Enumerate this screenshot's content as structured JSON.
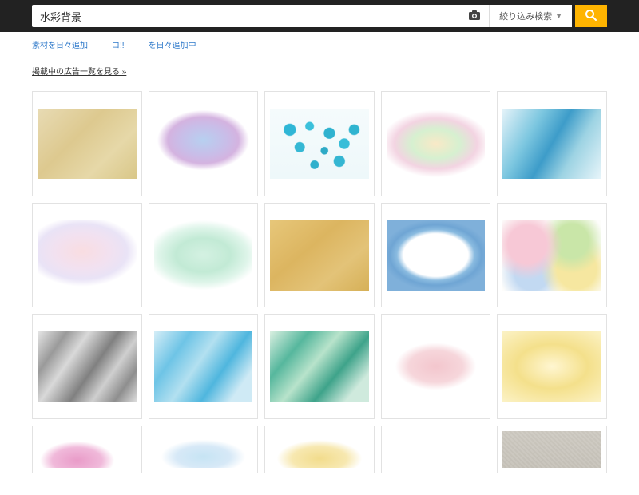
{
  "search": {
    "value": "水彩背景",
    "filter_label": "絞り込み検索"
  },
  "ad_snippets": [
    "素材を日々追加",
    "コ!!",
    "を日々追加中"
  ],
  "ads_list_link": "掲載中の広告一覧を見る »",
  "thumbs": {
    "row1": [
      {
        "name": "beige-paper",
        "bg": "linear-gradient(135deg,#e8dbb4 0%,#ddc98f 40%,#e6d8a8 70%,#d9c788 100%)"
      },
      {
        "name": "pastel-purple-blue",
        "bg": "radial-gradient(ellipse 60% 55% at 50% 45%, #b7d0f0 0%, #c9bde8 40%, #d4b3e0 60%, #fff 78%)"
      },
      {
        "name": "cyan-spots",
        "bg": "radial-gradient(circle at 20% 30%,#2fb6d6 0 6%,transparent 7%),radial-gradient(circle at 40% 25%,#3bc0db 0 5%,transparent 6%),radial-gradient(circle at 60% 35%,#2fb2cf 0 7%,transparent 8%),radial-gradient(circle at 30% 55%,#35b8d4 0 6%,transparent 7%),radial-gradient(circle at 55% 60%,#2daac6 0 5%,transparent 6%),radial-gradient(circle at 75% 50%,#38bdd8 0 6%,transparent 7%),radial-gradient(circle at 45% 80%,#2fb0cc 0 5%,transparent 6%),radial-gradient(circle at 70% 75%,#34b6d2 0 6%,transparent 7%),radial-gradient(circle at 85% 30%,#30b4d0 0 5%,transparent 6%),linear-gradient(#f5fbfc,#eef8fa)"
      },
      {
        "name": "pastel-green-pink",
        "bg": "radial-gradient(ellipse 70% 60% at 50% 50%, #f9e9c7 0%, #d6f0d0 35%, #f3d4e2 60%, #fff 80%)"
      },
      {
        "name": "blue-teal-wash",
        "bg": "linear-gradient(120deg,#e5f3f9 0%,#7dc7e0 30%,#3d9cc9 50%,#9dd3e3 70%,#e8f5fa 100%)"
      }
    ],
    "row2": [
      {
        "name": "pink-lilac-soft",
        "bg": "radial-gradient(ellipse 70% 60% at 45% 45%, #f9dde1 0%, #f2e1f0 40%, #e9e3f6 65%, #fff 82%)"
      },
      {
        "name": "mint-wash",
        "bg": "radial-gradient(ellipse 70% 60% at 50% 50%, #d4f1e2 0%, #c2ead5 40%, #dff5ea 65%, #fff 82%)"
      },
      {
        "name": "ochre-paper",
        "bg": "linear-gradient(140deg,#e7c77a 0%,#dcb560 40%,#e3c378 70%,#d6b057 100%)"
      },
      {
        "name": "blue-frame",
        "bg": "radial-gradient(ellipse 55% 50% at 50% 50%, #fff 0%, #fff 60%, #8abbe0 72%, #6fa5d4 85%, #7fb0da 100%)"
      },
      {
        "name": "rainbow-soft",
        "bg": "radial-gradient(circle at 25% 35%,#f7c8d6 0 22%,transparent 40%),radial-gradient(circle at 70% 30%,#c9e6a8 0 20%,transparent 38%),radial-gradient(circle at 75% 70%,#f6e7a0 0 22%,transparent 40%),radial-gradient(circle at 30% 75%,#c2d9f2 0 20%,transparent 38%),#fdfdfb"
      }
    ],
    "row3": [
      {
        "name": "grey-grunge",
        "bg": "linear-gradient(125deg,#e6e6e6 0%,#9a9a9a 20%,#d9d9d9 35%,#808080 55%,#cfcfcf 70%,#8e8e8e 85%,#dcdcdc 100%)"
      },
      {
        "name": "cyan-ice",
        "bg": "linear-gradient(125deg,#d4edf7 0%,#6ec4e6 25%,#b3e0f0 45%,#4fb6de 65%,#cfeaf5 85%)"
      },
      {
        "name": "teal-green-flow",
        "bg": "linear-gradient(130deg,#d9efe0 0%,#56b79d 25%,#b8e3cb 45%,#3ea38a 65%,#cfeadd 85%)"
      },
      {
        "name": "pink-blob",
        "bg": "radial-gradient(ellipse 55% 45% at 50% 50%, #f3c6cd 0%, #f6d6db 50%, #fff 75%)"
      },
      {
        "name": "yellow-glow",
        "bg": "radial-gradient(ellipse 80% 70% at 50% 50%, #fff6d1 0%, #f4e08b 45%, #f8e9a8 70%, #fcf4cc 100%)"
      }
    ],
    "row4": [
      {
        "name": "pink-clump",
        "bg": "radial-gradient(ellipse 50% 70% at 40% 80%, #e99bc8 0%, #f0b9da 50%, #fff 75%)"
      },
      {
        "name": "pastel-blob",
        "bg": "radial-gradient(ellipse 55% 60% at 50% 70%, #c6e4f4 0%, #d7e9f7 50%, #fff 78%)"
      },
      {
        "name": "yellow-blob",
        "bg": "radial-gradient(ellipse 55% 65% at 50% 75%, #f2dc8c 0%, #f7e8b0 50%, #fff 78%)"
      },
      {
        "name": "empty-white",
        "bg": "#fff"
      },
      {
        "name": "grey-fabric",
        "bg": "repeating-linear-gradient(45deg,#b3b0aa 0 2px,#a9a6a0 2px 4px),linear-gradient(#b0ada7,#a6a39d)",
        "blend": "overlay"
      }
    ]
  }
}
